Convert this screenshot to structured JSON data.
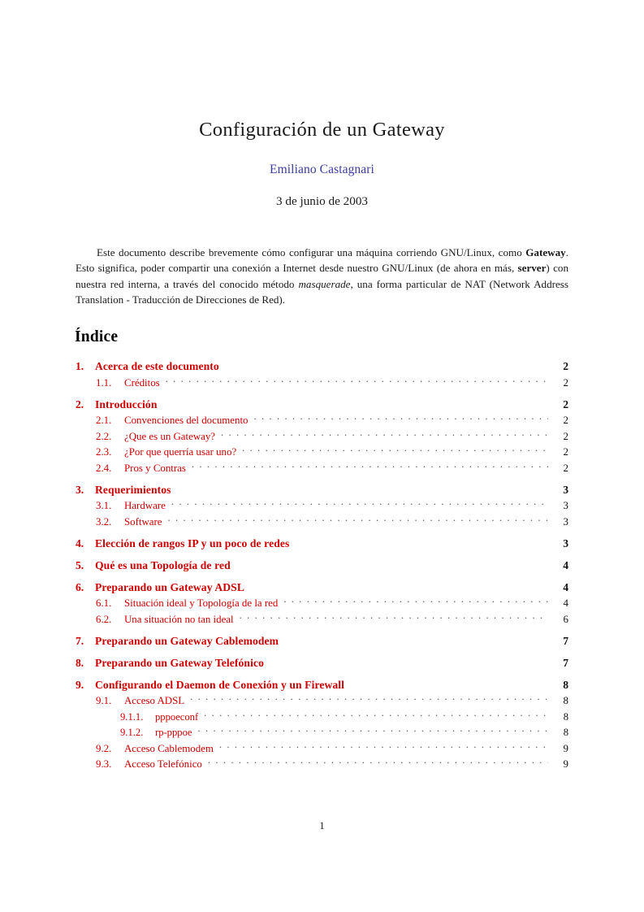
{
  "document": {
    "title": "Configuración de un Gateway",
    "author": "Emiliano Castagnari",
    "date": "3 de junio de 2003",
    "page_number": "1",
    "colors": {
      "link_red": "#cc0000",
      "author_blue": "#3b3b9e",
      "text_black": "#1a1a1a"
    }
  },
  "abstract": {
    "part1": "Este documento describe brevemente cómo configurar una máquina corriendo GNU/Linux, como ",
    "bold1": "Gateway",
    "part2": ". Esto significa, poder compartir una conexión a Internet desde nuestro GNU/Linux (de ahora en más, ",
    "bold2": "server",
    "part3": ") con nuestra red interna, a través del conocido método ",
    "italic1": "masquerade",
    "part4": ", una forma particular de NAT (Network Address Translation - Traducción de Direcciones de Red)."
  },
  "toc": {
    "heading": "Índice",
    "entries": [
      {
        "level": 1,
        "number": "1.",
        "text": "Acerca de este documento",
        "page": "2",
        "leader": false
      },
      {
        "level": 2,
        "number": "1.1.",
        "text": "Créditos",
        "page": "2",
        "leader": true
      },
      {
        "level": 1,
        "number": "2.",
        "text": "Introducción",
        "page": "2",
        "leader": false
      },
      {
        "level": 2,
        "number": "2.1.",
        "text": "Convenciones del documento",
        "page": "2",
        "leader": true
      },
      {
        "level": 2,
        "number": "2.2.",
        "text": "¿Que es un Gateway?",
        "page": "2",
        "leader": true
      },
      {
        "level": 2,
        "number": "2.3.",
        "text": "¿Por que querría usar uno?",
        "page": "2",
        "leader": true
      },
      {
        "level": 2,
        "number": "2.4.",
        "text": "Pros y Contras",
        "page": "2",
        "leader": true
      },
      {
        "level": 1,
        "number": "3.",
        "text": "Requerimientos",
        "page": "3",
        "leader": false
      },
      {
        "level": 2,
        "number": "3.1.",
        "text": "Hardware",
        "page": "3",
        "leader": true
      },
      {
        "level": 2,
        "number": "3.2.",
        "text": "Software",
        "page": "3",
        "leader": true
      },
      {
        "level": 1,
        "number": "4.",
        "text": "Elección de rangos IP y un poco de redes",
        "page": "3",
        "leader": false
      },
      {
        "level": 1,
        "number": "5.",
        "text": "Qué es una Topología de red",
        "page": "4",
        "leader": false
      },
      {
        "level": 1,
        "number": "6.",
        "text": "Preparando un Gateway ADSL",
        "page": "4",
        "leader": false
      },
      {
        "level": 2,
        "number": "6.1.",
        "text": "Situación ideal y Topología de la red",
        "page": "4",
        "leader": true
      },
      {
        "level": 2,
        "number": "6.2.",
        "text": "Una situación no tan ideal",
        "page": "6",
        "leader": true
      },
      {
        "level": 1,
        "number": "7.",
        "text": "Preparando un Gateway Cablemodem",
        "page": "7",
        "leader": false
      },
      {
        "level": 1,
        "number": "8.",
        "text": "Preparando un Gateway Telefónico",
        "page": "7",
        "leader": false
      },
      {
        "level": 1,
        "number": "9.",
        "text": "Configurando el Daemon de Conexión y un Firewall",
        "page": "8",
        "leader": false
      },
      {
        "level": 2,
        "number": "9.1.",
        "text": "Acceso ADSL",
        "page": "8",
        "leader": true
      },
      {
        "level": 3,
        "number": "9.1.1.",
        "text": "pppoeconf",
        "page": "8",
        "leader": true
      },
      {
        "level": 3,
        "number": "9.1.2.",
        "text": "rp-pppoe",
        "page": "8",
        "leader": true
      },
      {
        "level": 2,
        "number": "9.2.",
        "text": "Acceso Cablemodem",
        "page": "9",
        "leader": true
      },
      {
        "level": 2,
        "number": "9.3.",
        "text": "Acceso Telefónico",
        "page": "9",
        "leader": true
      }
    ]
  }
}
